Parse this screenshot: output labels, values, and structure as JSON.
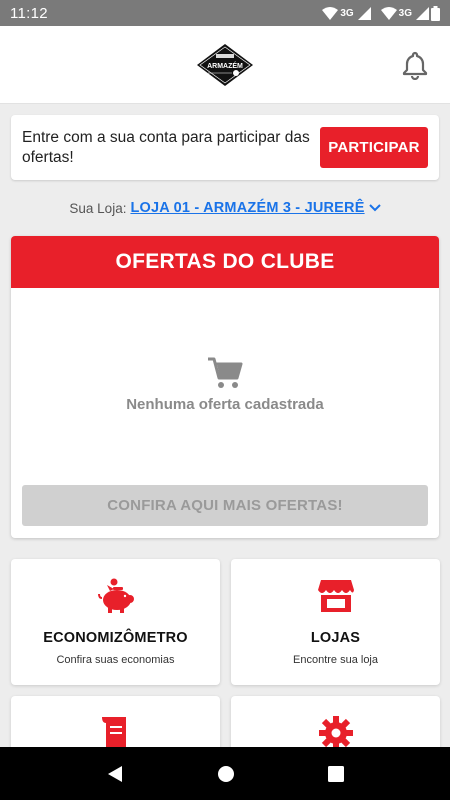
{
  "status_bar": {
    "time": "11:12",
    "network_1": "3G",
    "network_2": "3G"
  },
  "header": {
    "logo_text": "ARMAZÉM"
  },
  "login_card": {
    "message": "Entre com a sua conta para participar das ofertas!",
    "button_label": "PARTICIPAR"
  },
  "store": {
    "prefix": "Sua Loja:",
    "name": "LOJA 01 - ARMAZÉM 3 - JURERÊ"
  },
  "offers": {
    "title": "OFERTAS DO CLUBE",
    "empty_text": "Nenhuma oferta cadastrada",
    "more_button": "CONFIRA AQUI MAIS OFERTAS!"
  },
  "tiles": [
    {
      "title": "ECONOMIZÔMETRO",
      "subtitle": "Confira suas economias",
      "icon": "piggy-bank-icon"
    },
    {
      "title": "LOJAS",
      "subtitle": "Encontre sua loja",
      "icon": "store-icon"
    },
    {
      "title": "",
      "subtitle": "",
      "icon": "receipt-icon"
    },
    {
      "title": "",
      "subtitle": "",
      "icon": "gear-icon"
    }
  ],
  "colors": {
    "accent": "#e8202a",
    "link": "#1a73e8",
    "background": "#ededed"
  }
}
